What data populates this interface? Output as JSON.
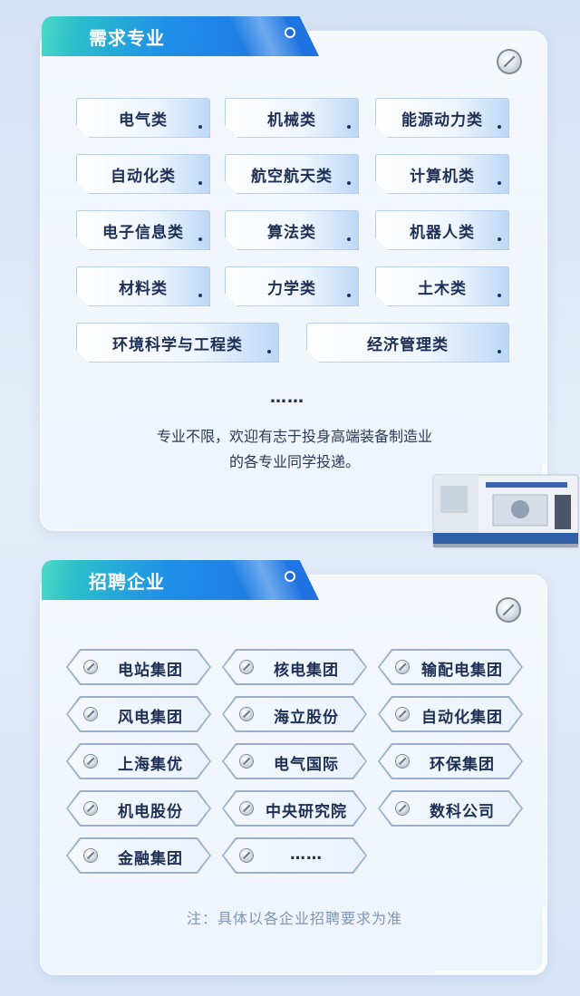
{
  "section1": {
    "title": "需求专业",
    "majors": [
      "电气类",
      "机械类",
      "能源动力类",
      "自动化类",
      "航空航天类",
      "计算机类",
      "电子信息类",
      "算法类",
      "机器人类",
      "材料类",
      "力学类",
      "土木类",
      "环境科学与工程类",
      "经济管理类"
    ],
    "ellipsis": "……",
    "description_line1": "专业不限，欢迎有志于投身高端装备制造业",
    "description_line2": "的各专业同学投递。"
  },
  "section2": {
    "title": "招聘企业",
    "companies": [
      "电站集团",
      "核电集团",
      "输配电集团",
      "风电集团",
      "海立股份",
      "自动化集团",
      "上海集优",
      "电气国际",
      "环保集团",
      "机电股份",
      "中央研究院",
      "数科公司",
      "金融集团",
      "……"
    ],
    "note": "注：具体以各企业招聘要求为准"
  },
  "colors": {
    "tab_gradient_start": "#4fd9c7",
    "tab_gradient_end": "#1f6fe0",
    "text_dark": "#1e2f55",
    "note_text": "#7f95b5"
  },
  "icons": {
    "panel_corner": "screw-icon",
    "company_marker": "screw-icon",
    "chip_marker": "dot-icon"
  }
}
